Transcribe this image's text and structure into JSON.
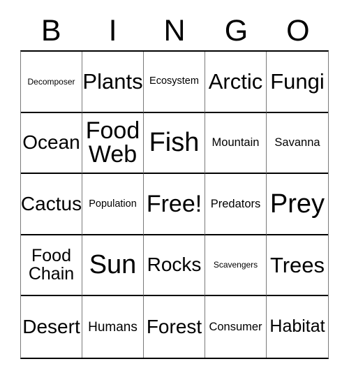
{
  "card": {
    "type": "bingo-card",
    "header_letters": [
      "B",
      "I",
      "N",
      "G",
      "O"
    ],
    "columns": 5,
    "rows": 5,
    "text_color": "#000000",
    "background_color": "#ffffff",
    "grid_line_color": "#7a7a7a",
    "grid_border_color": "#000000",
    "cells": [
      {
        "label": "Decomposer",
        "size": "fs-xxs"
      },
      {
        "label": "Plants",
        "size": "fs-xxl"
      },
      {
        "label": "Ecosystem",
        "size": "fs-xs"
      },
      {
        "label": "Arctic",
        "size": "fs-xxl"
      },
      {
        "label": "Fungi",
        "size": "fs-xxl"
      },
      {
        "label": "Ocean",
        "size": "fs-xl"
      },
      {
        "label": "Food\nWeb",
        "size": "fs-xxxl"
      },
      {
        "label": "Fish",
        "size": "fs-huge"
      },
      {
        "label": "Mountain",
        "size": "fs-s"
      },
      {
        "label": "Savanna",
        "size": "fs-s"
      },
      {
        "label": "Cactus",
        "size": "fs-xl"
      },
      {
        "label": "Population",
        "size": "fs-xs"
      },
      {
        "label": "Free!",
        "size": "fs-xxxl"
      },
      {
        "label": "Predators",
        "size": "fs-s"
      },
      {
        "label": "Prey",
        "size": "fs-huge"
      },
      {
        "label": "Food\nChain",
        "size": "fs-l"
      },
      {
        "label": "Sun",
        "size": "fs-huge"
      },
      {
        "label": "Rocks",
        "size": "fs-xl"
      },
      {
        "label": "Scavengers",
        "size": "fs-xxs"
      },
      {
        "label": "Trees",
        "size": "fs-xxl"
      },
      {
        "label": "Desert",
        "size": "fs-xl"
      },
      {
        "label": "Humans",
        "size": "fs-m"
      },
      {
        "label": "Forest",
        "size": "fs-xl"
      },
      {
        "label": "Consumer",
        "size": "fs-s"
      },
      {
        "label": "Habitat",
        "size": "fs-l"
      }
    ]
  }
}
